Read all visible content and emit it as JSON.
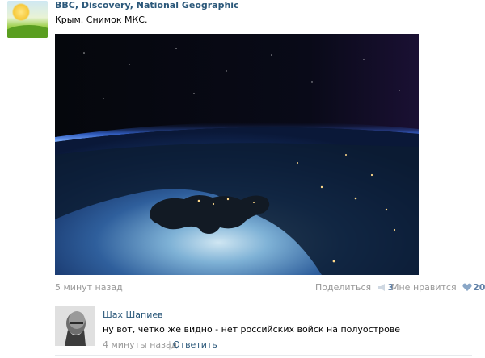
{
  "post": {
    "group_name": "BBC, Discovery, National Geographic",
    "text": "Крым. Снимок МКС.",
    "time": "5 минут назад",
    "share_label": "Поделиться",
    "share_count": "3",
    "like_label": "Мне нравится",
    "like_count": "20"
  },
  "comment": {
    "author": "Шах Шапиев",
    "text": "ну вот, четко же видно - нет российских войск на полуострове",
    "time": "4 минуты назад",
    "separator": "|",
    "reply_label": "Ответить"
  },
  "colors": {
    "link": "#2b587a",
    "muted": "#999999",
    "counter": "#5e7fa6"
  }
}
